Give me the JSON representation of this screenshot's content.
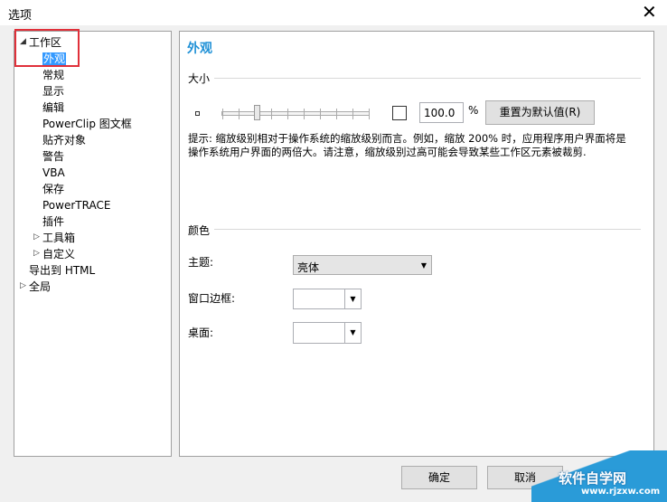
{
  "window": {
    "title": "选项",
    "close": "✕"
  },
  "tree": {
    "items": [
      {
        "label": "工作区",
        "level": 0,
        "expander": "◢"
      },
      {
        "label": "外观",
        "level": 1,
        "selected": true
      },
      {
        "label": "常规",
        "level": 1
      },
      {
        "label": "显示",
        "level": 1
      },
      {
        "label": "编辑",
        "level": 1
      },
      {
        "label": "PowerClip 图文框",
        "level": 1
      },
      {
        "label": "贴齐对象",
        "level": 1
      },
      {
        "label": "警告",
        "level": 1
      },
      {
        "label": "VBA",
        "level": 1
      },
      {
        "label": "保存",
        "level": 1
      },
      {
        "label": "PowerTRACE",
        "level": 1
      },
      {
        "label": "插件",
        "level": 1
      },
      {
        "label": "工具箱",
        "level": 1,
        "expander": "▷"
      },
      {
        "label": "自定义",
        "level": 1,
        "expander": "▷"
      },
      {
        "label": "导出到 HTML",
        "level": 0
      },
      {
        "label": "全局",
        "level": 0,
        "expander": "▷"
      }
    ]
  },
  "panel": {
    "heading": "外观",
    "size": {
      "label": "大小",
      "zoom_value": "100.0",
      "unit": "%",
      "reset": "重置为默认值(R)",
      "slider_fraction": 0.25,
      "hint1": "提示: 缩放级别相对于操作系统的缩放级别而言。例如，缩放 200% 时，应用程序用户界面将是",
      "hint2": "操作系统用户界面的两倍大。请注意，缩放级别过高可能会导致某些工作区元素被裁剪."
    },
    "color": {
      "label": "颜色",
      "theme_label": "主题:",
      "theme_value": "亮体",
      "border_label": "窗口边框:",
      "desktop_label": "桌面:"
    }
  },
  "buttons": {
    "ok": "确定",
    "cancel": "取消"
  },
  "watermark": {
    "text": "软件自学网",
    "url": "www.rjzxw.com"
  }
}
